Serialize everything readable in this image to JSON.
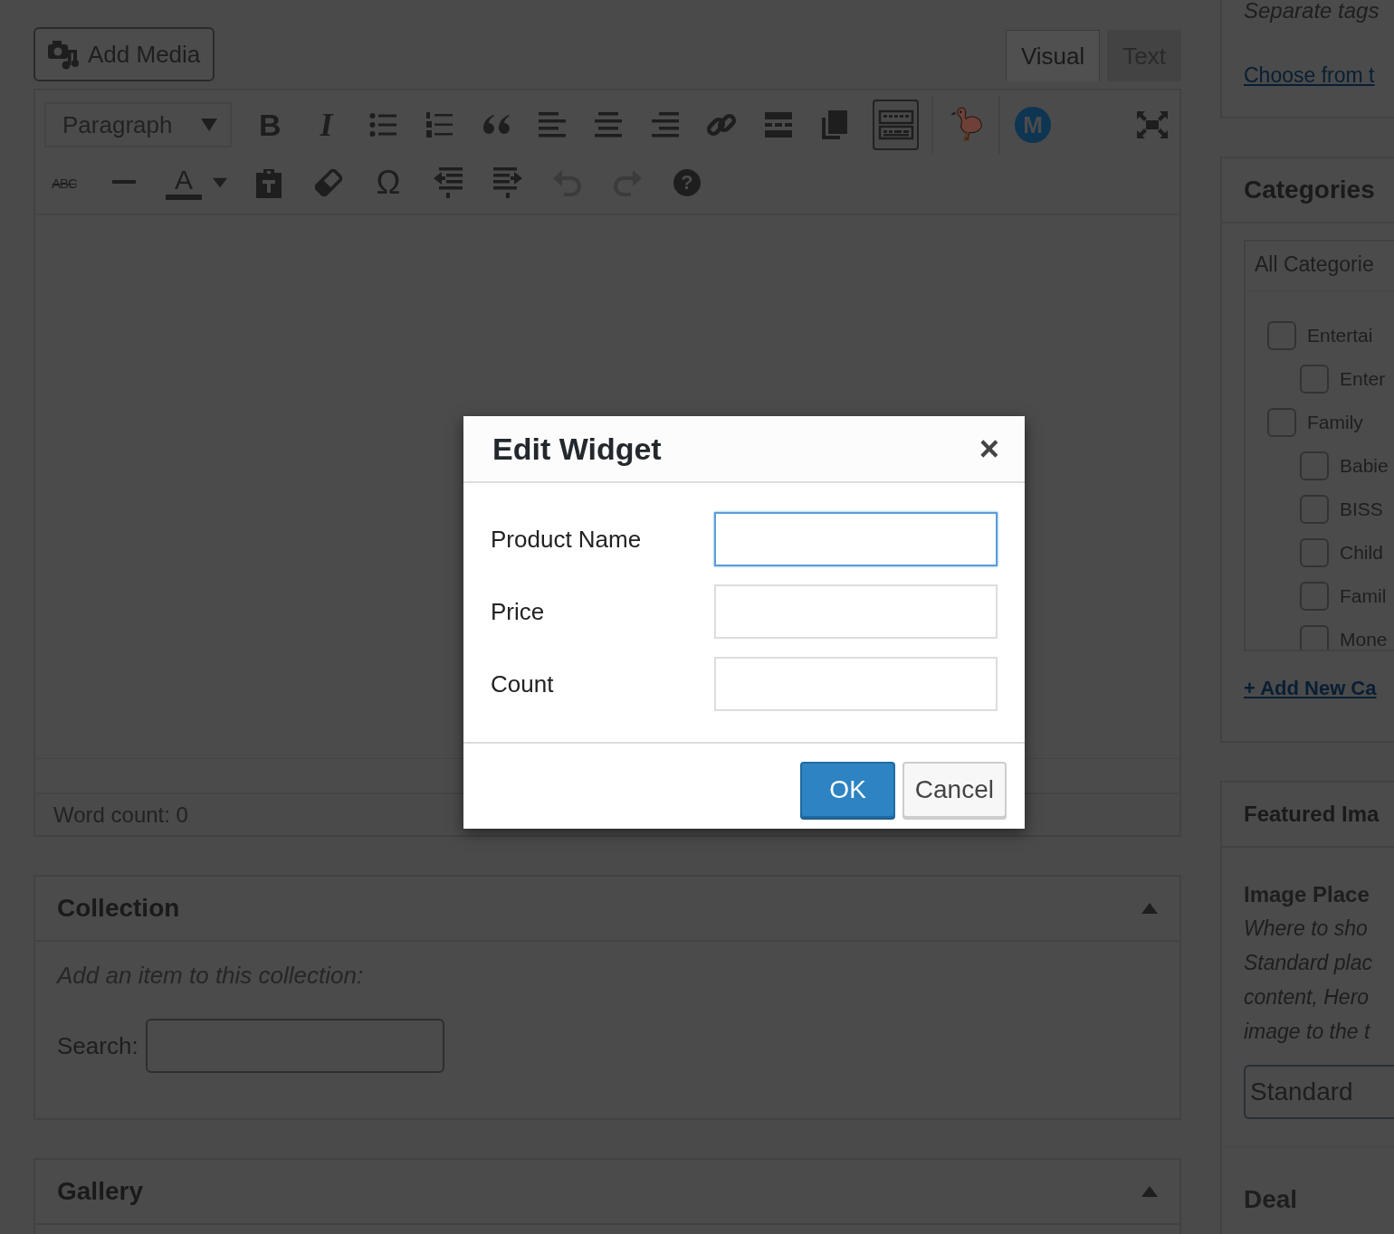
{
  "editor": {
    "add_media": {
      "label": "Add Media"
    },
    "tabs": [
      {
        "label": "Visual",
        "selected": true
      },
      {
        "label": "Text",
        "selected": false
      }
    ],
    "format_select": {
      "value": "Paragraph"
    },
    "toolbar_rows": [
      [
        {
          "kind": "bold",
          "label": "B",
          "active": false,
          "disabled": false
        },
        {
          "kind": "italic",
          "label": "I",
          "active": false,
          "disabled": false
        },
        {
          "kind": "bullist",
          "active": false,
          "disabled": false
        },
        {
          "kind": "numlist",
          "active": false,
          "disabled": false
        },
        {
          "kind": "blockquote",
          "active": false,
          "disabled": false
        },
        {
          "kind": "alignleft",
          "active": false,
          "disabled": false
        },
        {
          "kind": "aligncenter",
          "active": false,
          "disabled": false
        },
        {
          "kind": "alignright",
          "active": false,
          "disabled": false
        },
        {
          "kind": "link",
          "active": false,
          "disabled": false
        },
        {
          "kind": "more",
          "active": false,
          "disabled": false
        },
        {
          "kind": "copy",
          "active": false,
          "disabled": false
        },
        {
          "kind": "keyboard",
          "active": true,
          "disabled": false
        },
        {
          "kind": "divider"
        },
        {
          "kind": "flamingo",
          "active": false,
          "disabled": false
        },
        {
          "kind": "divider"
        },
        {
          "kind": "mcircle",
          "label": "M",
          "active": false,
          "disabled": false
        },
        {
          "kind": "spacer"
        },
        {
          "kind": "fullscreen",
          "active": false,
          "disabled": false
        }
      ],
      [
        {
          "kind": "strike",
          "label": "ABC",
          "active": false,
          "disabled": false
        },
        {
          "kind": "hr",
          "active": false,
          "disabled": false
        },
        {
          "kind": "textcolor",
          "label": "A",
          "active": false,
          "disabled": false
        },
        {
          "kind": "caret",
          "active": false,
          "disabled": false
        },
        {
          "kind": "paste",
          "active": false,
          "disabled": false
        },
        {
          "kind": "eraser",
          "active": false,
          "disabled": false
        },
        {
          "kind": "omega",
          "label": "Ω",
          "active": false,
          "disabled": false
        },
        {
          "kind": "outdent",
          "active": false,
          "disabled": false
        },
        {
          "kind": "indent",
          "active": false,
          "disabled": false
        },
        {
          "kind": "undo",
          "active": false,
          "disabled": true
        },
        {
          "kind": "redo",
          "active": false,
          "disabled": true
        },
        {
          "kind": "help",
          "label": "?",
          "active": false,
          "disabled": false
        }
      ]
    ],
    "status": "Word count: 0"
  },
  "panels": [
    {
      "title": "Collection",
      "expanded": true,
      "hint": "Add an item to this collection:",
      "search_label": "Search:"
    },
    {
      "title": "Gallery",
      "expanded": true
    }
  ],
  "sidebar": {
    "tags": {
      "hint": "Separate tags",
      "link": "Choose from t"
    },
    "categories": {
      "title": "Categories",
      "tab": "All Categorie",
      "items": [
        {
          "label": "Entertai",
          "checked": false,
          "children": [
            {
              "label": "Enter",
              "checked": false
            }
          ]
        },
        {
          "label": "Family",
          "checked": false,
          "children": [
            {
              "label": "Babie",
              "checked": false
            },
            {
              "label": "BISS",
              "checked": false
            },
            {
              "label": "Child",
              "checked": false
            },
            {
              "label": "Famil",
              "checked": false
            },
            {
              "label": "Mone",
              "checked": false
            }
          ]
        }
      ],
      "add_link": "+ Add New Ca"
    },
    "featured": {
      "title": "Featured Ima",
      "subtitle": "Image Place",
      "description_lines": [
        "Where to sho",
        "Standard plac",
        "content, Hero",
        "image to the t"
      ],
      "select": "Standard"
    },
    "deal": {
      "title": "Deal"
    }
  },
  "dialog": {
    "title": "Edit Widget",
    "close": "×",
    "fields": [
      {
        "label": "Product Name",
        "focused": true
      },
      {
        "label": "Price",
        "focused": false
      },
      {
        "label": "Count",
        "focused": false
      }
    ],
    "buttons": [
      {
        "label": "OK",
        "kind": "primary"
      },
      {
        "label": "Cancel",
        "kind": "secondary"
      }
    ]
  }
}
